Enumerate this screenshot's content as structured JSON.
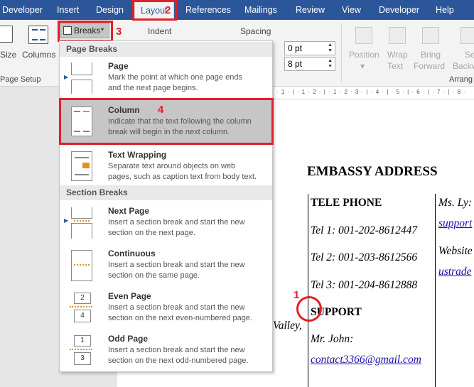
{
  "tabs": [
    {
      "label": "Developer"
    },
    {
      "label": "Insert"
    },
    {
      "label": "Design"
    },
    {
      "label": "Layout"
    },
    {
      "label": "References"
    },
    {
      "label": "Mailings"
    },
    {
      "label": "Review"
    },
    {
      "label": "View"
    },
    {
      "label": "Developer"
    },
    {
      "label": "Help"
    }
  ],
  "annotations": {
    "n1": "1",
    "n2": "2",
    "n3": "3",
    "n4": "4"
  },
  "ribbon": {
    "size": "Size",
    "columns": "Columns",
    "page_setup": "Page Setup",
    "breaks": "Breaks",
    "indent": "Indent",
    "spacing": "Spacing",
    "before_value": "0 pt",
    "after_value": "8 pt",
    "position": "Position",
    "wrap_text_1": "Wrap",
    "wrap_text_2": "Text",
    "bring_forward_1": "Bring",
    "bring_forward_2": "Forward",
    "send_backward_1": "Se",
    "send_backward_2": "Backw",
    "arrange": "Arrang"
  },
  "dropdown": {
    "page_breaks_header": "Page Breaks",
    "section_breaks_header": "Section Breaks",
    "items": [
      {
        "title": "Page",
        "desc": "Mark the point at which one page ends\nand the next page begins."
      },
      {
        "title": "Column",
        "desc": "Indicate that the text following the column\nbreak will begin in the next column."
      },
      {
        "title": "Text Wrapping",
        "desc": "Separate text around objects on web\npages, such as caption text from body text."
      },
      {
        "title": "Next Page",
        "desc": "Insert a section break and start the new\nsection on the next page."
      },
      {
        "title": "Continuous",
        "desc": "Insert a section break and start the new\nsection on the same page."
      },
      {
        "title": "Even Page",
        "desc": "Insert a section break and start the new\nsection on the next even-numbered page."
      },
      {
        "title": "Odd Page",
        "desc": "Insert a section break and start the new\nsection on the next odd-numbered page."
      }
    ]
  },
  "ruler_text": "· 1 · | · 1 · 2 · | · 1 · 2 · 3 · | · 4 · | · 5 · | · 6 · | · 7 · | · 8 ·",
  "document": {
    "heading": "EMBASSY ADDRESS",
    "telephone": "TELE PHONE",
    "tel1": "Tel 1: 001-202-8612447",
    "tel2": "Tel 2: 001-203-8612566",
    "tel3": "Tel 3: 001-204-8612888",
    "support": "SUPPORT",
    "mr_john": "Mr. John:",
    "email": "contact3366@gmail.com",
    "valley": "Valley,",
    "ms_ly": "Ms. Ly:",
    "support_link": "support",
    "website": "Website",
    "ustrade": "ustrade"
  },
  "colors": {
    "accent": "#2b579a",
    "annotation": "#e0202a",
    "highlight": "#c6c6c6"
  }
}
